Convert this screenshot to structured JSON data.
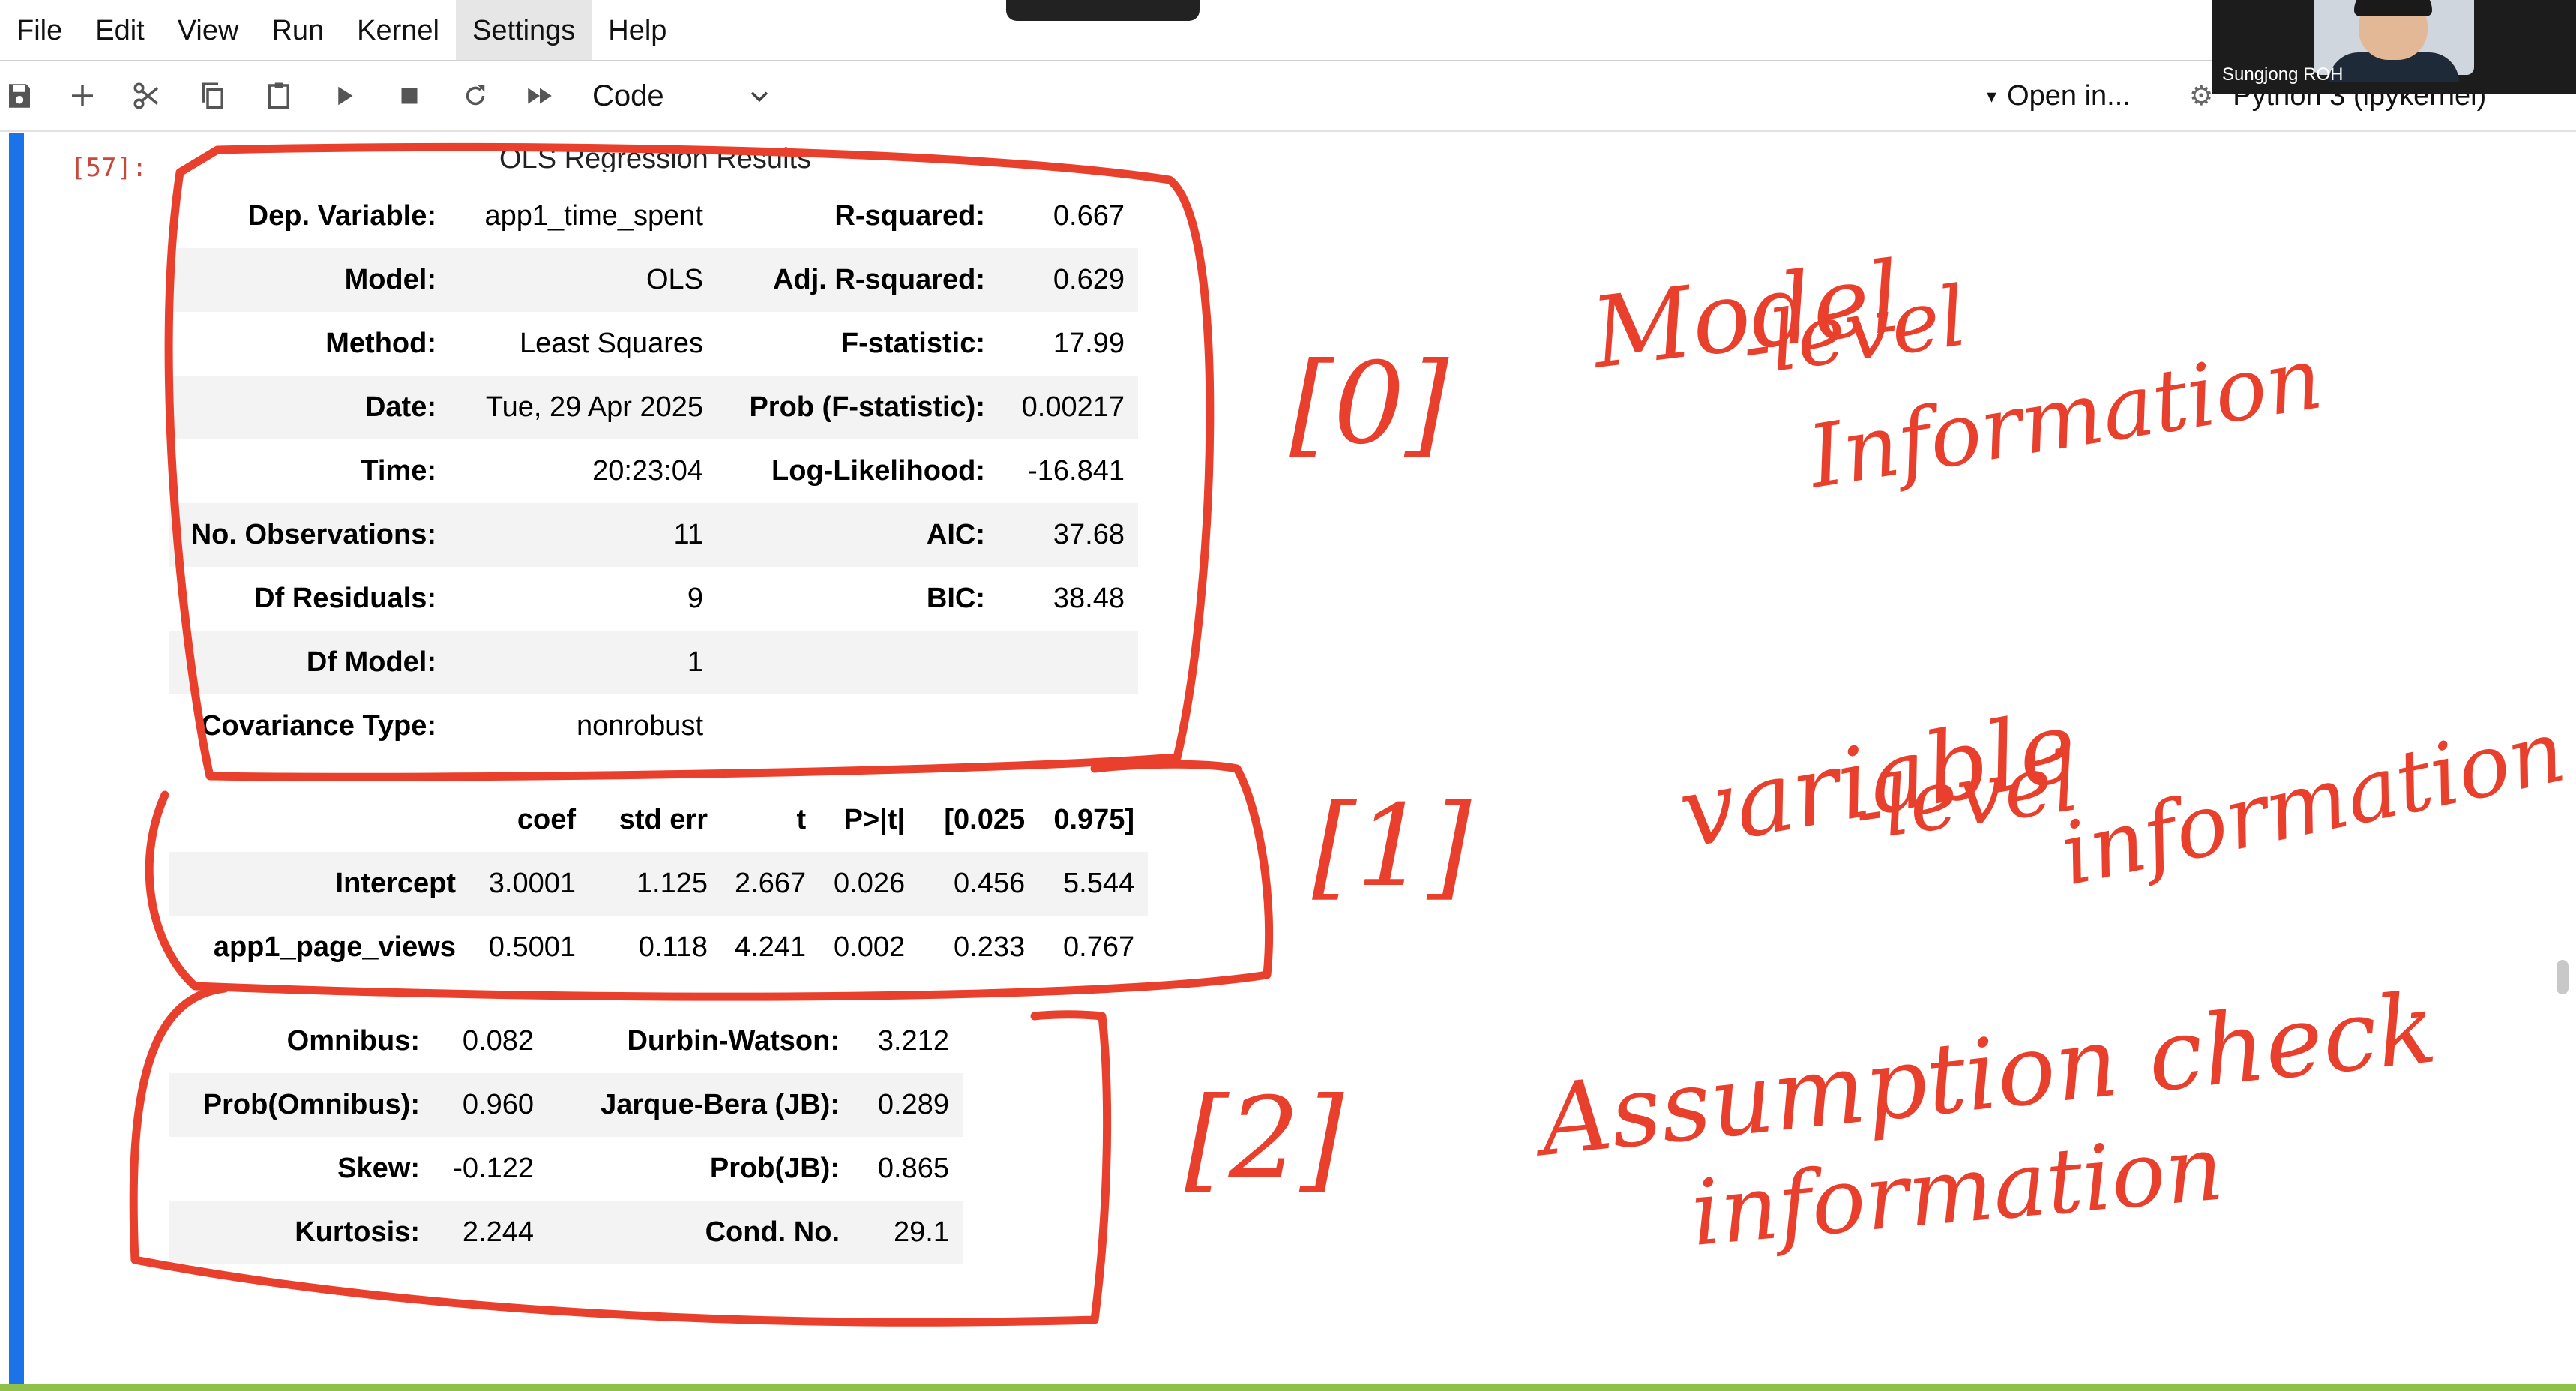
{
  "menu": [
    "File",
    "Edit",
    "View",
    "Run",
    "Kernel",
    "Settings",
    "Help"
  ],
  "menu_active": "Settings",
  "toolbar": {
    "cell_type": "Code",
    "open_in": "Open in...",
    "kernel": "Python 3 (ipykernel)"
  },
  "video": {
    "participant_name": "Sungjong ROH"
  },
  "cell": {
    "prompt": "[57]:",
    "title": "OLS Regression Results",
    "model_rows": [
      {
        "l1": "Dep. Variable:",
        "v1": "app1_time_spent",
        "l2": "R-squared:",
        "v2": "0.667"
      },
      {
        "l1": "Model:",
        "v1": "OLS",
        "l2": "Adj. R-squared:",
        "v2": "0.629"
      },
      {
        "l1": "Method:",
        "v1": "Least Squares",
        "l2": "F-statistic:",
        "v2": "17.99"
      },
      {
        "l1": "Date:",
        "v1": "Tue, 29 Apr 2025",
        "l2": "Prob (F-statistic):",
        "v2": "0.00217"
      },
      {
        "l1": "Time:",
        "v1": "20:23:04",
        "l2": "Log-Likelihood:",
        "v2": "-16.841"
      },
      {
        "l1": "No. Observations:",
        "v1": "11",
        "l2": "AIC:",
        "v2": "37.68"
      },
      {
        "l1": "Df Residuals:",
        "v1": "9",
        "l2": "BIC:",
        "v2": "38.48"
      },
      {
        "l1": "Df Model:",
        "v1": "1",
        "l2": "",
        "v2": ""
      },
      {
        "l1": "Covariance Type:",
        "v1": "nonrobust",
        "l2": "",
        "v2": ""
      }
    ],
    "coef_header": [
      "",
      "coef",
      "std err",
      "t",
      "P>|t|",
      "[0.025",
      "0.975]"
    ],
    "coef_rows": [
      [
        "Intercept",
        "3.0001",
        "1.125",
        "2.667",
        "0.026",
        "0.456",
        "5.544"
      ],
      [
        "app1_page_views",
        "0.5001",
        "0.118",
        "4.241",
        "0.002",
        "0.233",
        "0.767"
      ]
    ],
    "diag_rows": [
      {
        "l1": "Omnibus:",
        "v1": "0.082",
        "l2": "Durbin-Watson:",
        "v2": "3.212"
      },
      {
        "l1": "Prob(Omnibus):",
        "v1": "0.960",
        "l2": "Jarque-Bera (JB):",
        "v2": "0.289"
      },
      {
        "l1": "Skew:",
        "v1": "-0.122",
        "l2": "Prob(JB):",
        "v2": "0.865"
      },
      {
        "l1": "Kurtosis:",
        "v1": "2.244",
        "l2": "Cond. No.",
        "v2": "29.1"
      }
    ]
  },
  "annotations": {
    "a0_bracket": "[0]",
    "a0_line1": "Model",
    "a0_line2": "-level",
    "a0_line3": "Information",
    "a1_bracket": "[1]",
    "a1_line1": "variable",
    "a1_line2": "-level",
    "a1_line3": "information",
    "a2_bracket": "[2]",
    "a2_line1": "Assumption check",
    "a2_line2": "information",
    "ink_color": "#e8402c"
  }
}
